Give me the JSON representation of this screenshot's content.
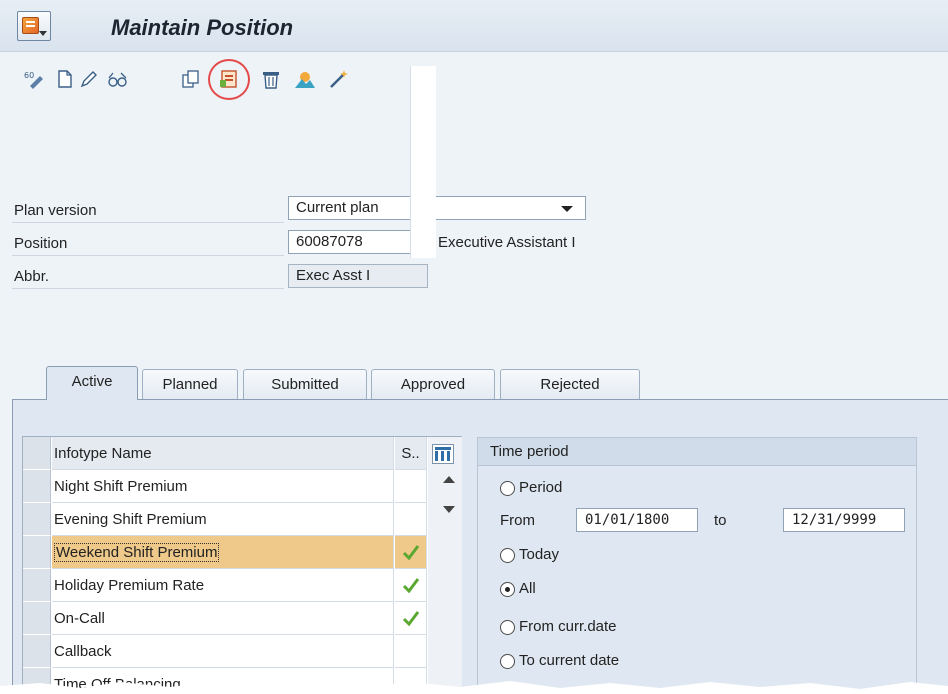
{
  "window": {
    "title": "Maintain Position"
  },
  "toolbar": {
    "buttons": [
      {
        "name": "change-icon"
      },
      {
        "name": "create-icon"
      },
      {
        "name": "edit-pencil-icon"
      },
      {
        "name": "display-glasses-icon"
      },
      {
        "name": "copy-icon"
      },
      {
        "name": "delimit-icon",
        "highlighted": true
      },
      {
        "name": "delete-trash-icon"
      },
      {
        "name": "overview-icon"
      },
      {
        "name": "wizard-wand-icon"
      }
    ],
    "highlight_color": "#e44a4a"
  },
  "form": {
    "plan_version_label": "Plan version",
    "plan_version_value": "Current plan",
    "position_label": "Position",
    "position_value": "60087078",
    "position_description": "Executive Assistant I",
    "abbr_label": "Abbr.",
    "abbr_value": "Exec Asst I"
  },
  "tabs": [
    {
      "label": "Active",
      "active": true
    },
    {
      "label": "Planned",
      "active": false
    },
    {
      "label": "Submitted",
      "active": false
    },
    {
      "label": "Approved",
      "active": false
    },
    {
      "label": "Rejected",
      "active": false
    }
  ],
  "table": {
    "columns": {
      "name": "Infotype Name",
      "status": "S.."
    },
    "rows": [
      {
        "name": "Night Shift Premium",
        "status": ""
      },
      {
        "name": "Evening Shift Premium",
        "status": ""
      },
      {
        "name": "Weekend Shift Premium",
        "status": "check",
        "selected": true
      },
      {
        "name": "Holiday Premium Rate",
        "status": "check"
      },
      {
        "name": "On-Call",
        "status": "check"
      },
      {
        "name": "Callback",
        "status": ""
      },
      {
        "name": "Time Off Balancing",
        "status": ""
      }
    ],
    "highlight_color": "#eec98a",
    "check_color": "#5aa832"
  },
  "time_period": {
    "title": "Time period",
    "options": {
      "period": "Period",
      "today": "Today",
      "all": "All",
      "from_curr": "From curr.date",
      "to_current": "To current date"
    },
    "selected": "all",
    "from_label": "From",
    "from_value": "01/01/1800",
    "to_label": "to",
    "to_value": "12/31/9999"
  }
}
